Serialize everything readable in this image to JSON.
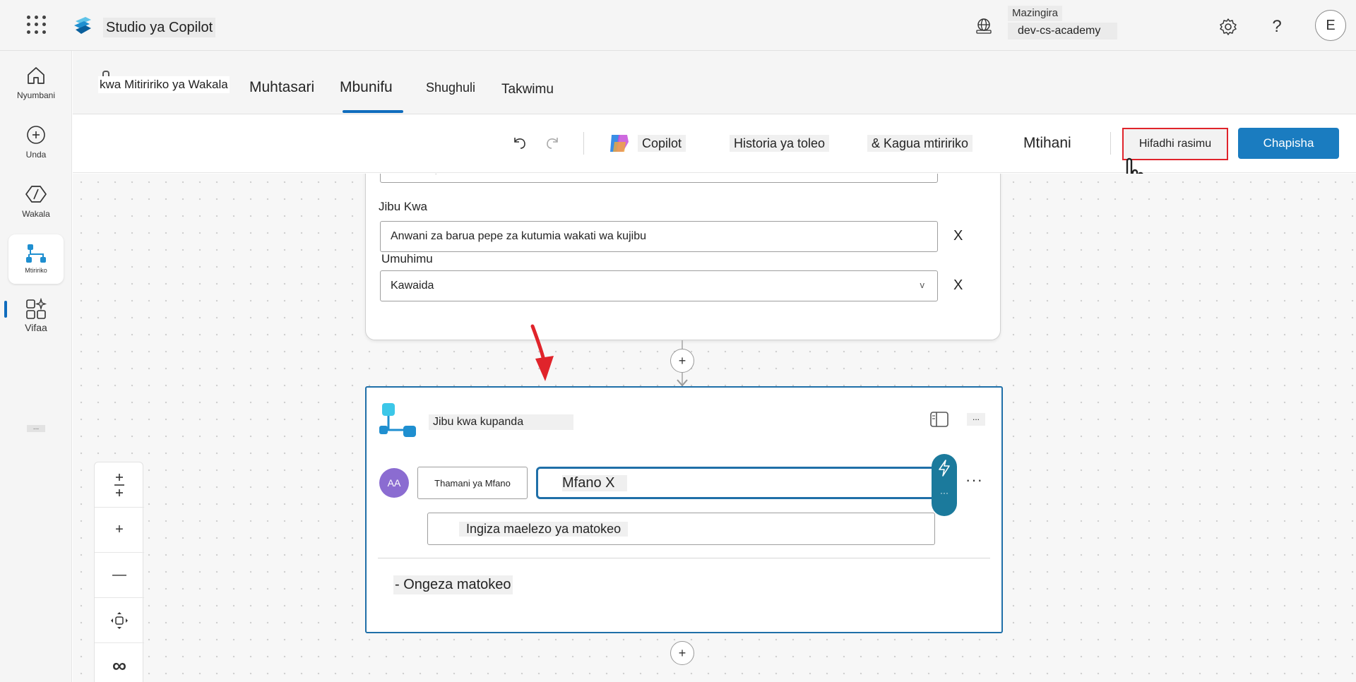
{
  "app": {
    "title": "Studio ya Copilot",
    "environment_label": "Mazingira",
    "environment_value": "dev-cs-academy",
    "user_initial": "E",
    "help_label": "?"
  },
  "leftnav": {
    "items": [
      {
        "label": "Nyumbani",
        "icon": "home-icon"
      },
      {
        "label": "Unda",
        "icon": "create-icon"
      },
      {
        "label": "Wakala",
        "icon": "agents-icon"
      },
      {
        "label": "Mtiririko",
        "icon": "flows-icon"
      },
      {
        "label": "Vifaa",
        "icon": "tools-icon"
      }
    ],
    "more_label": "..."
  },
  "tabs": {
    "breadcrumb": "kwa Mitiririko ya Wakala",
    "items": [
      "Muhtasari",
      "Mbunifu",
      "Shughuli",
      "Takwimu"
    ],
    "active": "Mbunifu"
  },
  "toolbar": {
    "copilot_label": "Copilot",
    "version_history_label": "Historia ya toleo",
    "flow_checker_label": "& Kagua mtiririko",
    "test_label": "Mtihani",
    "save_draft_label": "Hifadhi rasimu",
    "publish_label": "Chapisha"
  },
  "card_top": {
    "sensitivity_placeholder": "Sensitivity",
    "reply_to_label": "Jibu Kwa",
    "reply_to_placeholder": "Anwani za barua pepe za kutumia wakati wa kujibu",
    "importance_label": "Umuhimu",
    "importance_value": "Kawaida",
    "clear_label": "X",
    "chevron": "v"
  },
  "card_main": {
    "title": "Jibu kwa kupanda",
    "more_label": "...",
    "avatar_initials": "AA",
    "type_value": "Thamani ya Mfano",
    "value_text": "Mfano X",
    "description_placeholder": "Ingiza maelezo ya matokeo",
    "add_output_label": "- Ongeza matokeo",
    "row_more_label": "···"
  },
  "canvas": {
    "add_step_symbol": "+",
    "zoom_in_symbol": "+",
    "zoom_out_symbol": "—",
    "fit_symbol": "∞"
  },
  "colors": {
    "accent": "#0f6cbd",
    "publish": "#1a7cc0",
    "highlight": "#e0242b",
    "node_border": "#1f6fa8",
    "avatar": "#8b6cd1"
  }
}
